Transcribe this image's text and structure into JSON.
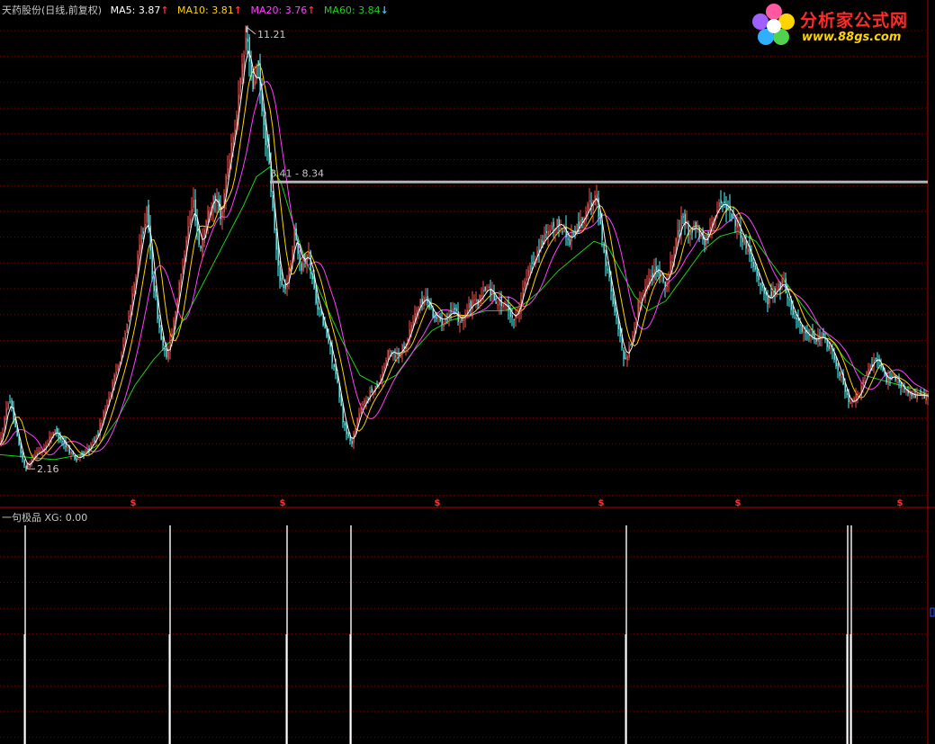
{
  "header": {
    "stock_title": "天药股份(日线,前复权)",
    "ma5_label": "MA5:",
    "ma5_value": "3.87",
    "ma10_label": "MA10:",
    "ma10_value": "3.81",
    "ma20_label": "MA20:",
    "ma20_value": "3.76",
    "ma60_label": "MA60:",
    "ma60_value": "3.84",
    "arrow_up": "↑",
    "arrow_down": "↓"
  },
  "sub_panel": {
    "indicator_name": "一句极品",
    "xg_label": "XG:",
    "xg_value": "0.00"
  },
  "logo": {
    "site_name": "分析家公式网",
    "site_url": "www.88gs.com"
  },
  "colors": {
    "background": "#000000",
    "grid": "#7a0000",
    "divider": "#b00000",
    "up_candle": "#ff5050",
    "down_candle": "#54ffff",
    "ma5": "#ffffff",
    "ma10": "#ffd200",
    "ma20": "#ff40ff",
    "ma60": "#19d219",
    "price_line": "#b4b4b4",
    "signal_bar": "#ffffff",
    "signal_marker": "#ff3030"
  },
  "chart_data": {
    "type": "line",
    "title": "天药股份(日线,前复权)",
    "xlabel": "",
    "ylabel": "",
    "ylim": [
      1.8,
      11.5
    ],
    "high_label": "11.21",
    "high_value": 11.21,
    "low_label": "2.16",
    "low_value": 2.16,
    "range_label": "8.41 - 8.34",
    "range_value": 8.34,
    "signal_marker": "$",
    "price_path": [
      [
        0,
        2.9
      ],
      [
        10,
        3.9
      ],
      [
        18,
        3.1
      ],
      [
        28,
        2.4
      ],
      [
        38,
        2.7
      ],
      [
        48,
        2.8
      ],
      [
        60,
        3.2
      ],
      [
        72,
        2.9
      ],
      [
        85,
        2.6
      ],
      [
        98,
        2.8
      ],
      [
        108,
        3.1
      ],
      [
        118,
        3.7
      ],
      [
        128,
        4.3
      ],
      [
        138,
        5.0
      ],
      [
        148,
        6.0
      ],
      [
        156,
        7.0
      ],
      [
        163,
        7.6
      ],
      [
        170,
        6.2
      ],
      [
        178,
        5.1
      ],
      [
        185,
        4.6
      ],
      [
        192,
        5.3
      ],
      [
        200,
        6.2
      ],
      [
        208,
        7.2
      ],
      [
        215,
        7.8
      ],
      [
        222,
        6.8
      ],
      [
        230,
        7.5
      ],
      [
        238,
        8.0
      ],
      [
        245,
        7.4
      ],
      [
        252,
        8.4
      ],
      [
        260,
        9.2
      ],
      [
        268,
        10.3
      ],
      [
        274,
        11.21
      ],
      [
        280,
        10.0
      ],
      [
        286,
        10.6
      ],
      [
        292,
        9.4
      ],
      [
        298,
        8.7
      ],
      [
        303,
        7.6
      ],
      [
        308,
        6.6
      ],
      [
        314,
        6.0
      ],
      [
        320,
        6.2
      ],
      [
        327,
        7.2
      ],
      [
        335,
        6.5
      ],
      [
        342,
        6.8
      ],
      [
        350,
        5.9
      ],
      [
        358,
        5.4
      ],
      [
        366,
        4.9
      ],
      [
        374,
        4.2
      ],
      [
        382,
        3.3
      ],
      [
        390,
        2.9
      ],
      [
        398,
        3.5
      ],
      [
        406,
        3.8
      ],
      [
        414,
        4.0
      ],
      [
        422,
        4.2
      ],
      [
        432,
        4.8
      ],
      [
        442,
        4.7
      ],
      [
        452,
        5.0
      ],
      [
        462,
        5.6
      ],
      [
        472,
        5.9
      ],
      [
        482,
        5.5
      ],
      [
        492,
        5.4
      ],
      [
        502,
        5.6
      ],
      [
        512,
        5.4
      ],
      [
        522,
        5.7
      ],
      [
        532,
        5.8
      ],
      [
        542,
        6.1
      ],
      [
        552,
        5.8
      ],
      [
        562,
        5.7
      ],
      [
        572,
        5.4
      ],
      [
        582,
        6.1
      ],
      [
        592,
        6.6
      ],
      [
        602,
        7.0
      ],
      [
        612,
        7.2
      ],
      [
        622,
        7.4
      ],
      [
        632,
        7.0
      ],
      [
        642,
        7.3
      ],
      [
        652,
        7.6
      ],
      [
        662,
        8.0
      ],
      [
        670,
        6.9
      ],
      [
        678,
        6.1
      ],
      [
        686,
        5.3
      ],
      [
        694,
        4.6
      ],
      [
        702,
        5.0
      ],
      [
        710,
        5.8
      ],
      [
        720,
        6.2
      ],
      [
        730,
        6.5
      ],
      [
        740,
        6.1
      ],
      [
        750,
        6.9
      ],
      [
        758,
        7.5
      ],
      [
        766,
        7.2
      ],
      [
        774,
        7.3
      ],
      [
        782,
        6.9
      ],
      [
        792,
        7.5
      ],
      [
        802,
        7.8
      ],
      [
        812,
        7.6
      ],
      [
        822,
        7.2
      ],
      [
        832,
        6.8
      ],
      [
        842,
        6.3
      ],
      [
        852,
        5.8
      ],
      [
        862,
        6.0
      ],
      [
        870,
        6.2
      ],
      [
        880,
        5.6
      ],
      [
        892,
        5.2
      ],
      [
        904,
        5.0
      ],
      [
        914,
        5.1
      ],
      [
        924,
        4.8
      ],
      [
        934,
        4.3
      ],
      [
        944,
        3.7
      ],
      [
        954,
        3.9
      ],
      [
        964,
        4.4
      ],
      [
        974,
        4.7
      ],
      [
        984,
        4.2
      ],
      [
        994,
        4.3
      ],
      [
        1004,
        4.0
      ],
      [
        1014,
        3.9
      ],
      [
        1024,
        3.9
      ],
      [
        1032,
        3.87
      ]
    ],
    "ma60_path": [
      [
        0,
        2.7
      ],
      [
        30,
        2.65
      ],
      [
        60,
        2.6
      ],
      [
        90,
        2.7
      ],
      [
        110,
        2.9
      ],
      [
        130,
        3.4
      ],
      [
        150,
        4.1
      ],
      [
        170,
        4.6
      ],
      [
        190,
        5.0
      ],
      [
        210,
        5.6
      ],
      [
        230,
        6.3
      ],
      [
        250,
        7.0
      ],
      [
        270,
        7.7
      ],
      [
        285,
        8.3
      ],
      [
        300,
        8.5
      ],
      [
        312,
        8.2
      ],
      [
        325,
        7.4
      ],
      [
        340,
        6.6
      ],
      [
        360,
        5.8
      ],
      [
        380,
        5.0
      ],
      [
        400,
        4.3
      ],
      [
        420,
        4.1
      ],
      [
        440,
        4.3
      ],
      [
        460,
        4.8
      ],
      [
        480,
        5.2
      ],
      [
        500,
        5.4
      ],
      [
        520,
        5.5
      ],
      [
        540,
        5.6
      ],
      [
        560,
        5.6
      ],
      [
        580,
        5.7
      ],
      [
        600,
        6.0
      ],
      [
        620,
        6.4
      ],
      [
        640,
        6.7
      ],
      [
        660,
        7.0
      ],
      [
        675,
        6.9
      ],
      [
        690,
        6.4
      ],
      [
        705,
        5.9
      ],
      [
        720,
        5.6
      ],
      [
        740,
        5.8
      ],
      [
        760,
        6.3
      ],
      [
        780,
        6.8
      ],
      [
        800,
        7.1
      ],
      [
        820,
        7.2
      ],
      [
        840,
        7.0
      ],
      [
        860,
        6.5
      ],
      [
        880,
        6.0
      ],
      [
        900,
        5.5
      ],
      [
        920,
        5.1
      ],
      [
        940,
        4.6
      ],
      [
        960,
        4.3
      ],
      [
        980,
        4.2
      ],
      [
        1000,
        4.1
      ],
      [
        1020,
        4.0
      ],
      [
        1032,
        3.9
      ]
    ],
    "signal_positions": [
      28,
      189,
      319,
      390,
      696,
      942,
      946
    ],
    "series": [
      {
        "name": "MA5",
        "value": 3.87
      },
      {
        "name": "MA10",
        "value": 3.81
      },
      {
        "name": "MA20",
        "value": 3.76
      },
      {
        "name": "MA60",
        "value": 3.84
      }
    ],
    "sub_series": {
      "name": "XG",
      "value": 0.0
    }
  }
}
